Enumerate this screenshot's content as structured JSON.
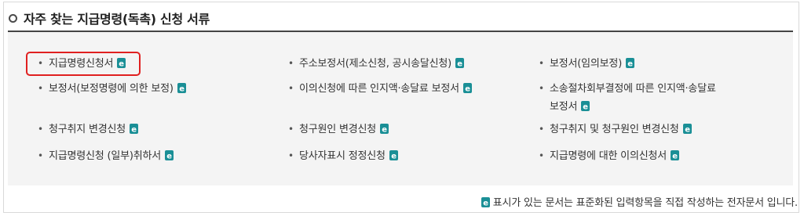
{
  "section": {
    "title": "자주 찾는 지급명령(독촉) 신청 서류"
  },
  "documents": [
    {
      "label": "지급명령신청서",
      "highlighted": true
    },
    {
      "label": "주소보정서(제소신청, 공시송달신청)"
    },
    {
      "label": "보정서(임의보정)"
    },
    {
      "label": "보정서(보정명령에 의한 보정)"
    },
    {
      "label": "이의신청에 따른 인지액·송달료 보정서"
    },
    {
      "label": "소송절차회부결정에 따른 인지액·송달료",
      "label_line2": "보정서"
    },
    {
      "label": "청구취지 변경신청"
    },
    {
      "label": "청구원인 변경신청"
    },
    {
      "label": "청구취지 및 청구원인 변경신청"
    },
    {
      "label": "지급명령신청 (일부)취하서"
    },
    {
      "label": "당사자표시 정정신청"
    },
    {
      "label": "지급명령에 대한 이의신청서"
    }
  ],
  "bullet": "•",
  "icon": "electronic-form-icon",
  "footnote": "표시가 있는 문서는 표준화된 입력항목을 직접 작성하는 전자문서 입니다.",
  "colors": {
    "icon_teal": "#1a8f96",
    "highlight_red": "#e02020",
    "panel_bg": "#f4f4f4",
    "title_rule": "#444444"
  }
}
